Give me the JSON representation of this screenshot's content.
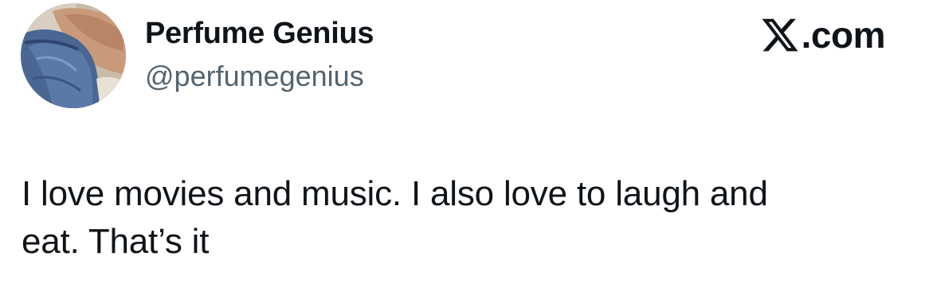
{
  "author": {
    "display_name": "Perfume Genius",
    "handle": "@perfumegenius",
    "avatar_icon": "profile-photo"
  },
  "brand": {
    "logo_icon": "x-logo-icon",
    "suffix": ".com"
  },
  "tweet": {
    "lines": [
      "I love movies and music. I also love to laugh and",
      "eat. That’s it"
    ]
  },
  "colors": {
    "text_primary": "#0f1419",
    "text_secondary": "#536471",
    "background": "#ffffff"
  }
}
